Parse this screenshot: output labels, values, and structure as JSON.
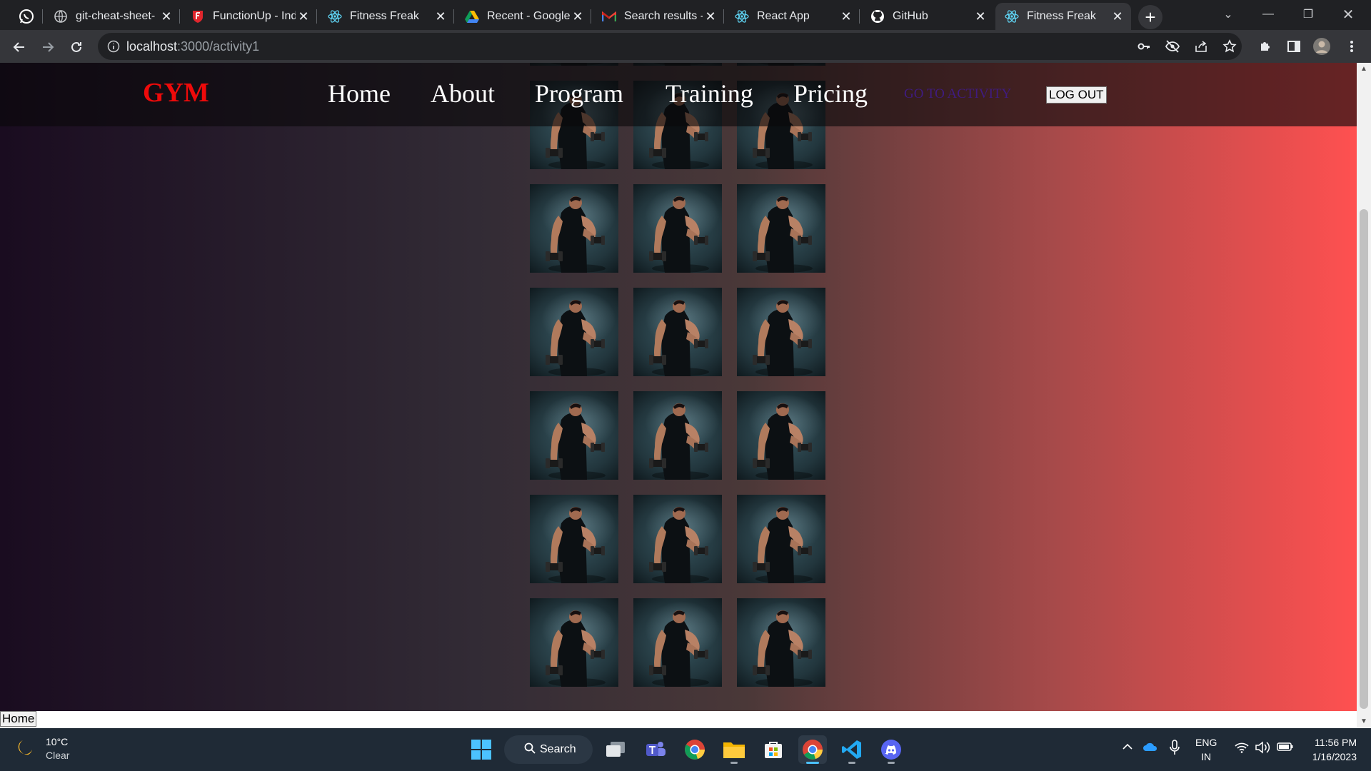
{
  "browser": {
    "tabs": [
      {
        "title": "",
        "icon": "whatsapp-icon"
      },
      {
        "title": "git-cheat-sheet-",
        "icon": "globe-icon"
      },
      {
        "title": "FunctionUp - Ind",
        "icon": "functionup-icon"
      },
      {
        "title": "Fitness Freak",
        "icon": "react-icon"
      },
      {
        "title": "Recent - Google",
        "icon": "google-drive-icon"
      },
      {
        "title": "Search results - ",
        "icon": "gmail-icon"
      },
      {
        "title": "React App",
        "icon": "react-icon"
      },
      {
        "title": "GitHub",
        "icon": "github-icon"
      },
      {
        "title": "Fitness Freak",
        "icon": "react-icon",
        "active": true
      }
    ],
    "url_host": "localhost",
    "url_path": ":3000/activity1"
  },
  "site": {
    "logo": "GYM",
    "nav": [
      "Home",
      "About",
      "Program",
      "Training",
      "Pricing"
    ],
    "activity_link": "GO TO ACTIVITY",
    "logout_label": "LOG OUT",
    "home_button": "Home",
    "colors": {
      "logo": "#ee0a0a",
      "gradient_start": "#1a0c20",
      "gradient_end": "#ff5050",
      "activity_link": "#3f1b80"
    }
  },
  "gallery": {
    "image": "man-lifting-dumbbell",
    "columns": 3,
    "rows_visible": 7,
    "count": 21
  },
  "taskbar": {
    "weather_temp": "10°C",
    "weather_desc": "Clear",
    "search_label": "Search",
    "lang_top": "ENG",
    "lang_bottom": "IN",
    "time": "11:56 PM",
    "date": "1/16/2023"
  }
}
